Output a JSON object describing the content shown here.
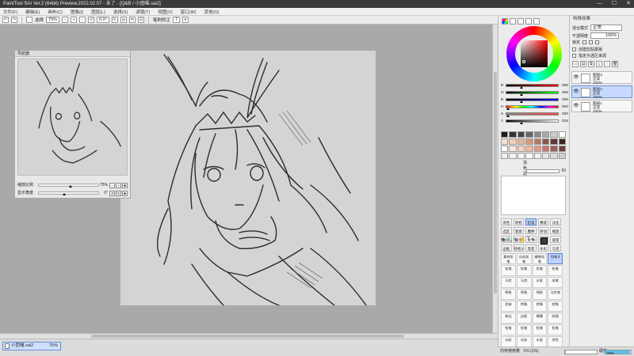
{
  "window": {
    "title": "PaintTool SAI Ver.2 (64bit) Preview.2022.02.07 - 未了 - [Q&B / 小团喵.sai2]",
    "controls": [
      "—",
      "☐",
      "✕"
    ]
  },
  "menu": [
    "文件(F)",
    "编辑(E)",
    "画布(C)",
    "图像(I)",
    "图层(L)",
    "选择(S)",
    "滤镜(T)",
    "视图(V)",
    "窗口(W)",
    "其他(O)"
  ],
  "toolbar": {
    "select_label": "选择",
    "zoom_value": "75%",
    "rotate_value": "0.0°",
    "stabilizer_label": "笔刷修正",
    "stabilizer_value": "7"
  },
  "navigator": {
    "title": "导航器",
    "zoom_label": "缩放比例",
    "zoom_value": "75%",
    "zoom_level": 0.5,
    "angle_label": "显示角度",
    "angle_value": "0°",
    "angle_level": 0.4
  },
  "document_tab": {
    "name": "小团喵.sai2",
    "zoom": "75%"
  },
  "color_panel": {
    "sliders": [
      {
        "channel": "R",
        "value": "066",
        "level": 0.26,
        "gradient": "linear-gradient(to right,#000,#f00)"
      },
      {
        "channel": "G",
        "value": "066",
        "level": 0.26,
        "gradient": "linear-gradient(to right,#000,#0f0)"
      },
      {
        "channel": "B",
        "value": "066",
        "level": 0.26,
        "gradient": "linear-gradient(to right,#000,#00f)"
      },
      {
        "channel": "H",
        "value": "000",
        "level": 0.0,
        "gradient": "linear-gradient(to right,#f00,#ff0,#0f0,#0ff,#00f,#f0f,#f00)"
      },
      {
        "channel": "S",
        "value": "000",
        "level": 0.0,
        "gradient": "linear-gradient(to right,#888,#f44)"
      },
      {
        "channel": "V",
        "value": "026",
        "level": 0.26,
        "gradient": "linear-gradient(to right,#000,#fff)"
      }
    ],
    "swatches": [
      "#1a1a1a",
      "#333333",
      "#444444",
      "#666666",
      "#888888",
      "#aaaaaa",
      "#cccccc",
      "#ffffff",
      "#f7e1cf",
      "#f2cdb4",
      "#e8b797",
      "#d89a7b",
      "#b87660",
      "#8a5648",
      "#5a3a32",
      "#3a2620",
      "#ffffff",
      "#fde9dc",
      "#fad2bd",
      "#f3b89c",
      "#e39a82",
      "#c8776a",
      "#a05f55",
      "#6e3f3a",
      "#eeeeee",
      "#f0f0f0",
      "#f5f5f5",
      "#fafafa",
      "#f2f2f2",
      "#e6e6e6",
      "#dddddd",
      "#d0d0d0"
    ],
    "mix_label": "混色滤镜",
    "mix_value": "50"
  },
  "tool_panel": {
    "tools": [
      "涂色",
      "喷枪",
      "铅笔",
      "橡皮",
      "淡化",
      "选区",
      "套索",
      "魔棒",
      "移动",
      "缩放",
      "旋转",
      "抓手",
      "文字",
      "图形",
      "吸管",
      "边框",
      "喷枪2",
      "渐变",
      "水彩",
      "马克"
    ],
    "active_tool": "铅笔",
    "brushes": [
      "素材铅笔",
      "自动铅笔",
      "硬笔铅笔",
      "铅笔 Ⅱ",
      "铅笔",
      "铅笔",
      "铅笔",
      "铅笔",
      "马克",
      "马克",
      "水彩",
      "毛笔",
      "喷枪",
      "喷枪",
      "喷枪",
      "马克笔",
      "涂抹",
      "特殊",
      "特殊",
      "特殊",
      "抹边",
      "边框",
      "模糊",
      "纹理",
      "铅笔",
      "铅笔",
      "铅笔",
      "铅笔",
      "水彩",
      "水彩",
      "水彩",
      "涂色"
    ],
    "active_brush": 3
  },
  "layer_panel": {
    "title": "特殊效果",
    "blend_label": "混合模式",
    "blend_value": "正常",
    "opacity_label": "不透明度",
    "opacity_value": "100%",
    "lock_label": "锁定",
    "clip_label": "创建剪贴蒙版",
    "select_source_label": "指定为选区来源",
    "layers": [
      {
        "name": "图层3",
        "mode": "正常",
        "opacity": "100%",
        "visible": true,
        "active": false
      },
      {
        "name": "图层2",
        "mode": "正常",
        "opacity": "100%",
        "visible": true,
        "active": true
      },
      {
        "name": "图层1",
        "mode": "正常",
        "opacity": "100%",
        "visible": true,
        "active": false
      }
    ]
  },
  "status": {
    "memory_label": "内存使用量",
    "memory_value": "1% (1%)",
    "disk_label": "硬盘",
    "disk_value": "98%",
    "memory_level": 0.01,
    "disk_level": 0.98
  }
}
